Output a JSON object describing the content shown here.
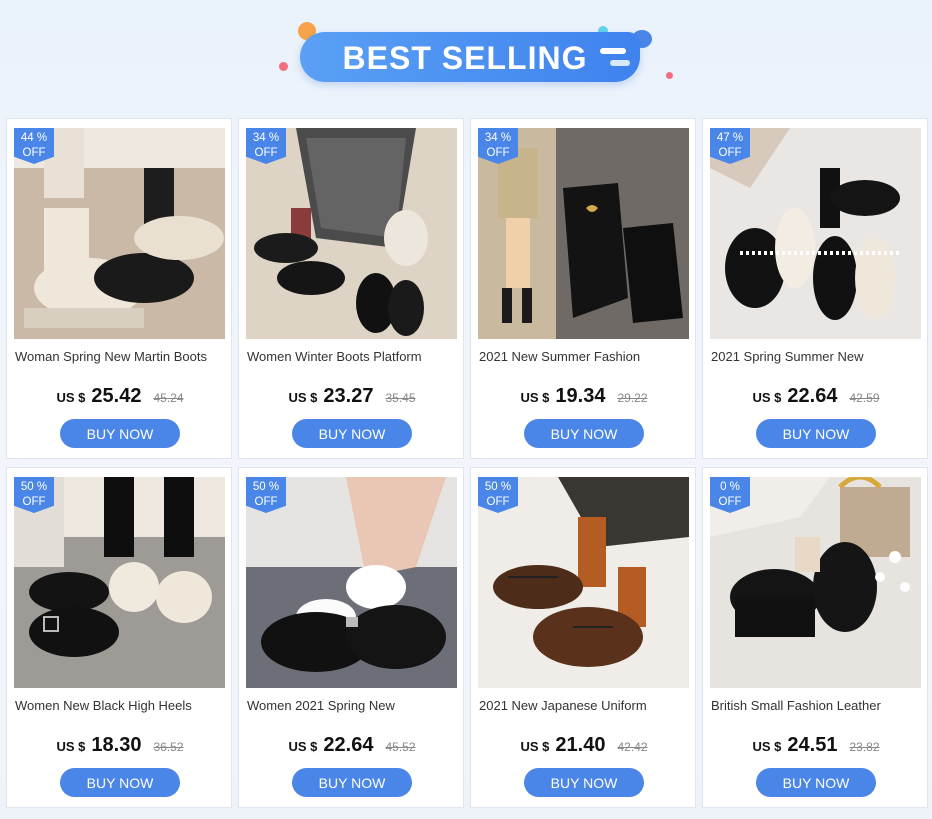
{
  "banner": {
    "title": "BEST SELLING",
    "colors": {
      "pill": "#4a86e8",
      "accent_orange": "#f7a34b",
      "accent_pink": "#f26d7d",
      "accent_cyan": "#5fd3e8"
    }
  },
  "theme": {
    "button": "#4a86e8",
    "badge": "#4a86e8"
  },
  "products": [
    {
      "discount_pct": "44 %",
      "discount_off": "OFF",
      "title": "Woman Spring New Martin Boots",
      "currency": "US $",
      "price": "25.42",
      "old_price": "45.24",
      "button": "BUY NOW",
      "image": "cream-and-black-martin-boots-photo"
    },
    {
      "discount_pct": "34 %",
      "discount_off": "OFF",
      "title": "Women Winter Boots Platform",
      "currency": "US $",
      "price": "23.27",
      "old_price": "35.45",
      "button": "BUY NOW",
      "image": "black-lace-up-platform-shoes-photo"
    },
    {
      "discount_pct": "34 %",
      "discount_off": "OFF",
      "title": "2021 New Summer Fashion",
      "currency": "US $",
      "price": "19.34",
      "old_price": "29.22",
      "button": "BUY NOW",
      "image": "black-loafers-photo"
    },
    {
      "discount_pct": "47 %",
      "discount_off": "OFF",
      "title": "2021 Spring Summer New",
      "currency": "US $",
      "price": "22.64",
      "old_price": "42.59",
      "button": "BUY NOW",
      "image": "pearl-strap-mary-janes-photo"
    },
    {
      "discount_pct": "50 %",
      "discount_off": "OFF",
      "title": "Women New Black High Heels",
      "currency": "US $",
      "price": "18.30",
      "old_price": "36.52",
      "button": "BUY NOW",
      "image": "buckle-strap-shoes-photo"
    },
    {
      "discount_pct": "50 %",
      "discount_off": "OFF",
      "title": "Women 2021 Spring New",
      "currency": "US $",
      "price": "22.64",
      "old_price": "45.52",
      "button": "BUY NOW",
      "image": "black-mary-janes-frilly-socks-photo"
    },
    {
      "discount_pct": "50 %",
      "discount_off": "OFF",
      "title": "2021 New Japanese Uniform",
      "currency": "US $",
      "price": "21.40",
      "old_price": "42.42",
      "button": "BUY NOW",
      "image": "brown-lace-up-oxfords-photo"
    },
    {
      "discount_pct": "0  %",
      "discount_off": "OFF",
      "title": "British Small Fashion Leather",
      "currency": "US $",
      "price": "24.51",
      "old_price": "23.82",
      "button": "BUY NOW",
      "image": "black-platform-oxfords-photo"
    }
  ]
}
